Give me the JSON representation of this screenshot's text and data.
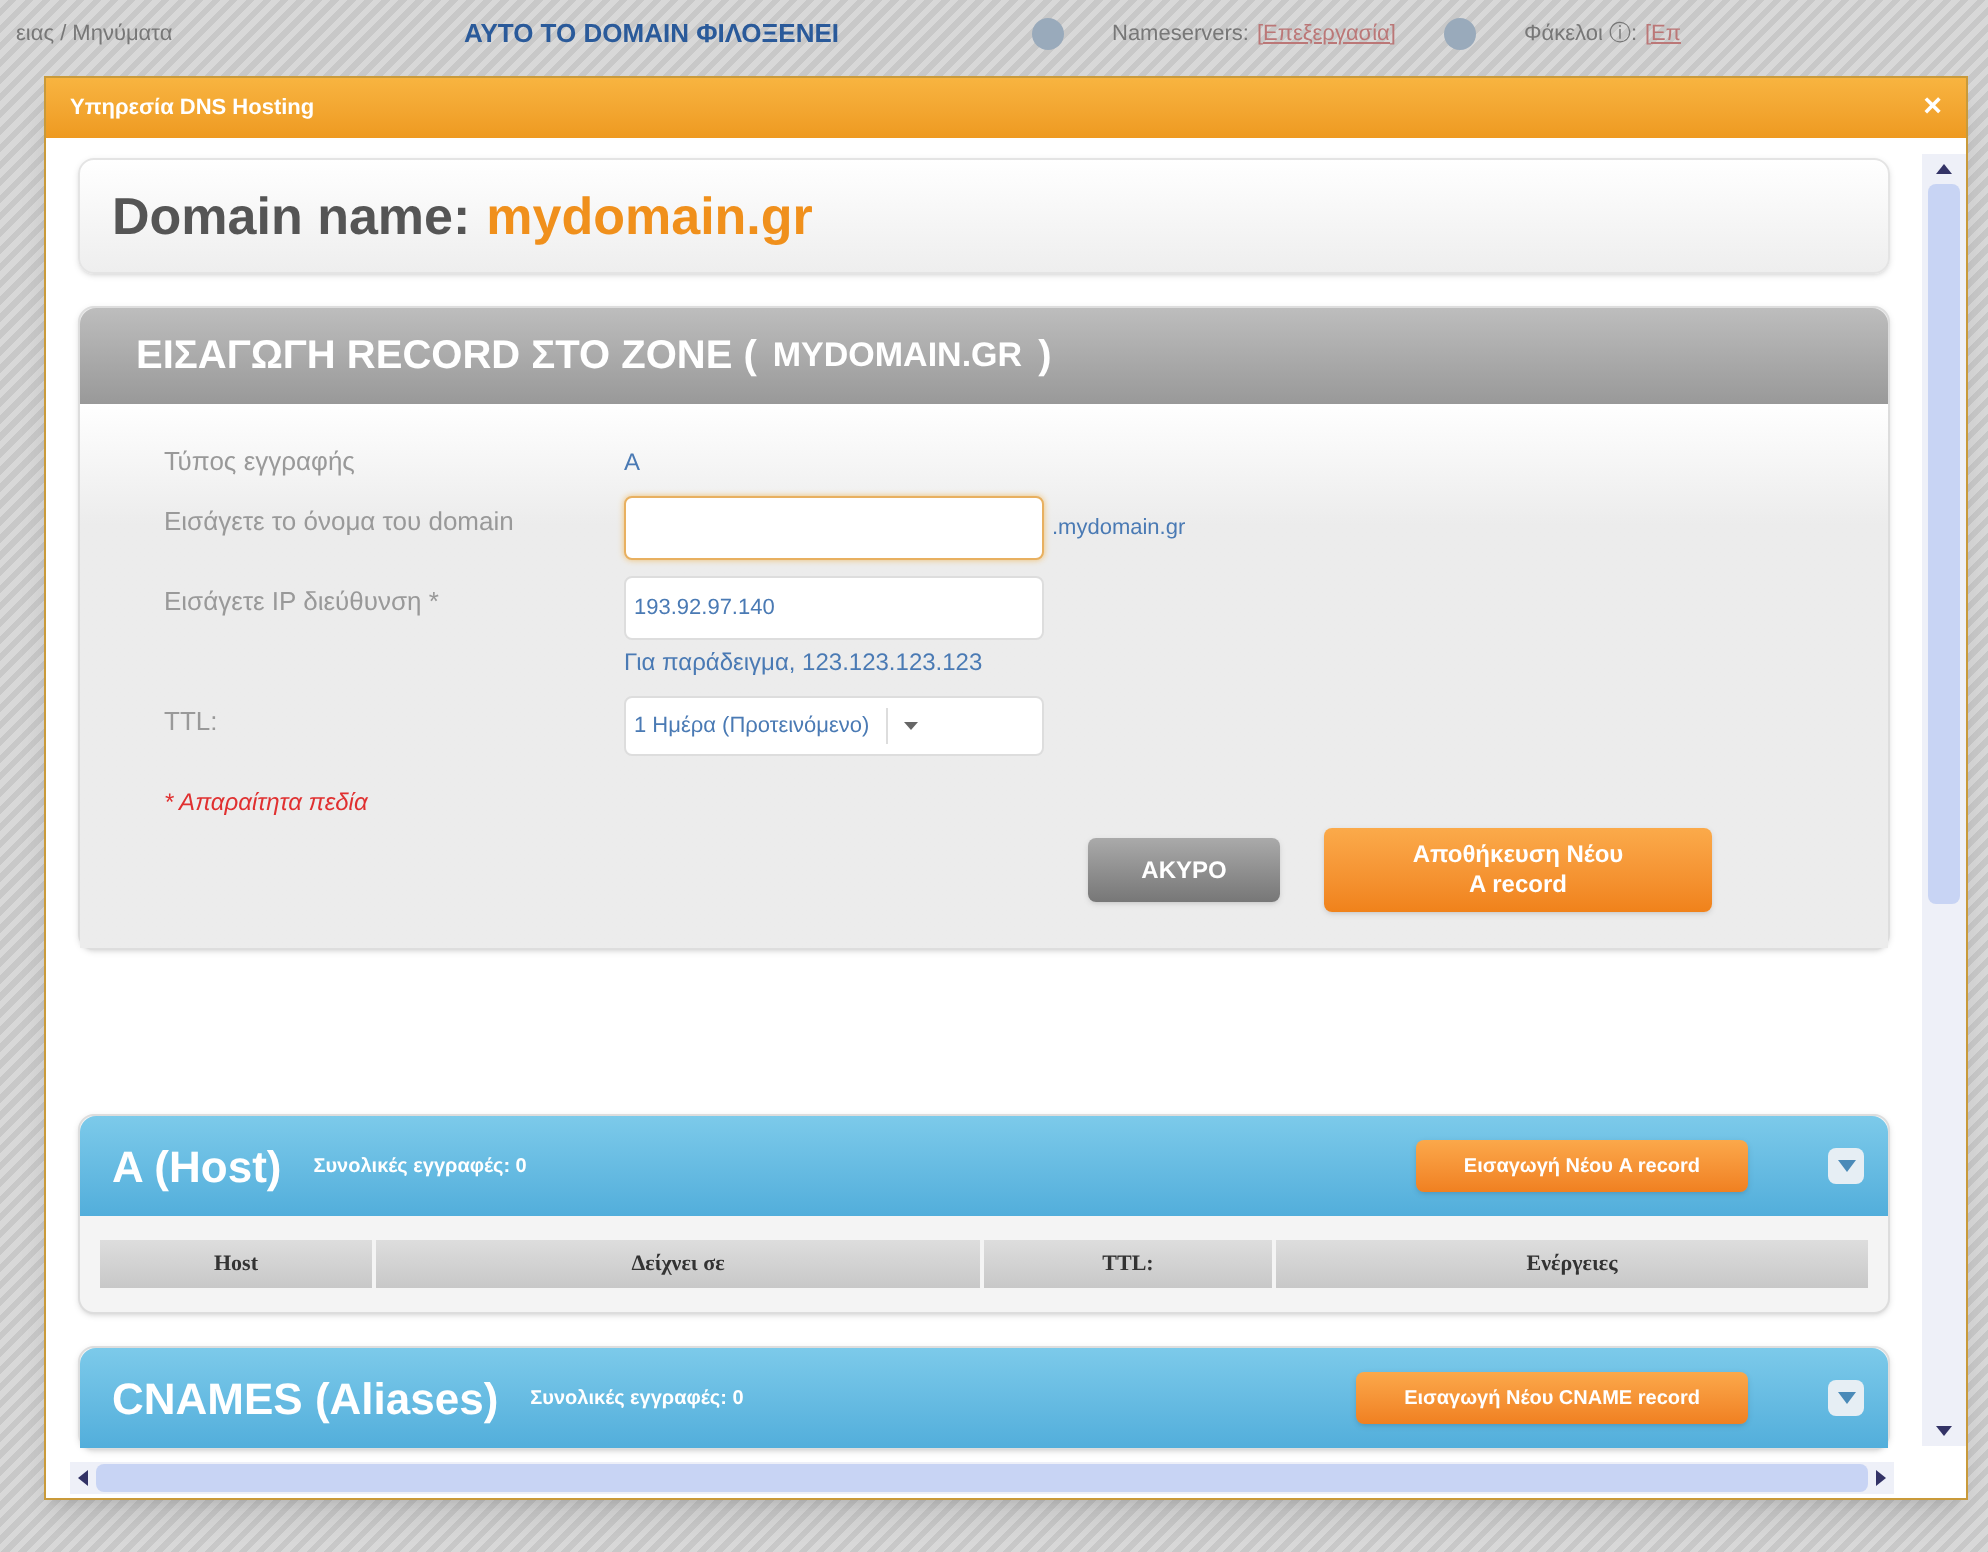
{
  "background": {
    "breadcrumb": "ειας / Μηνύματα",
    "notice": "ΑΥΤΟ ΤΟ DOMAIN ΦΙΛΟΞΕΝΕΙ",
    "nameservers_label": "Nameservers:",
    "nameservers_link": "[Επεξεργασία]",
    "folders_label": "Φάκελοι ⓘ:",
    "folders_link": "[Επ"
  },
  "dialog": {
    "title": "Υπηρεσία DNS Hosting",
    "close": "×"
  },
  "domain": {
    "label": "Domain name:",
    "value": "mydomain.gr"
  },
  "form": {
    "heading": "ΕΙΣΑΓΩΓΗ RECORD ΣΤΟ ZONE (",
    "heading_domain": "MYDOMAIN.GR",
    "heading_end": ")",
    "fields": [
      {
        "kind": "static",
        "label": "Τύπος εγγραφής",
        "value": "A"
      },
      {
        "kind": "text",
        "label": "Εισάγετε το όνομα του domain",
        "focused": true,
        "suffix": ".mydomain.gr"
      },
      {
        "kind": "text",
        "label": "Εισάγετε IP διεύθυνση *",
        "value": "193.92.97.140",
        "focused": false,
        "hint": "Για παράδειγμα, 123.123.123.123"
      },
      {
        "kind": "select",
        "label": "TTL:",
        "value": "1 Ημέρα (Προτεινόμενο)"
      }
    ],
    "required_note": "* Απαραίτητα πεδία",
    "buttons": [
      {
        "kind": "secondary",
        "label": "ΑΚΥΡΟ"
      },
      {
        "kind": "primary",
        "label": "Αποθήκευση Νέου A record"
      }
    ]
  },
  "record_panels": [
    {
      "title": "A (Host)",
      "count": "Συνολικές εγγραφές: 0",
      "add_button": "Εισαγωγή Νέου A record",
      "columns": [
        "Host",
        "Δείχνει σε",
        "TTL:",
        "Ενέργειες"
      ]
    },
    {
      "title": "CNAMES (Aliases)",
      "count": "Συνολικές εγγραφές: 0",
      "add_button": "Εισαγωγή Νέου CNAME record"
    }
  ]
}
